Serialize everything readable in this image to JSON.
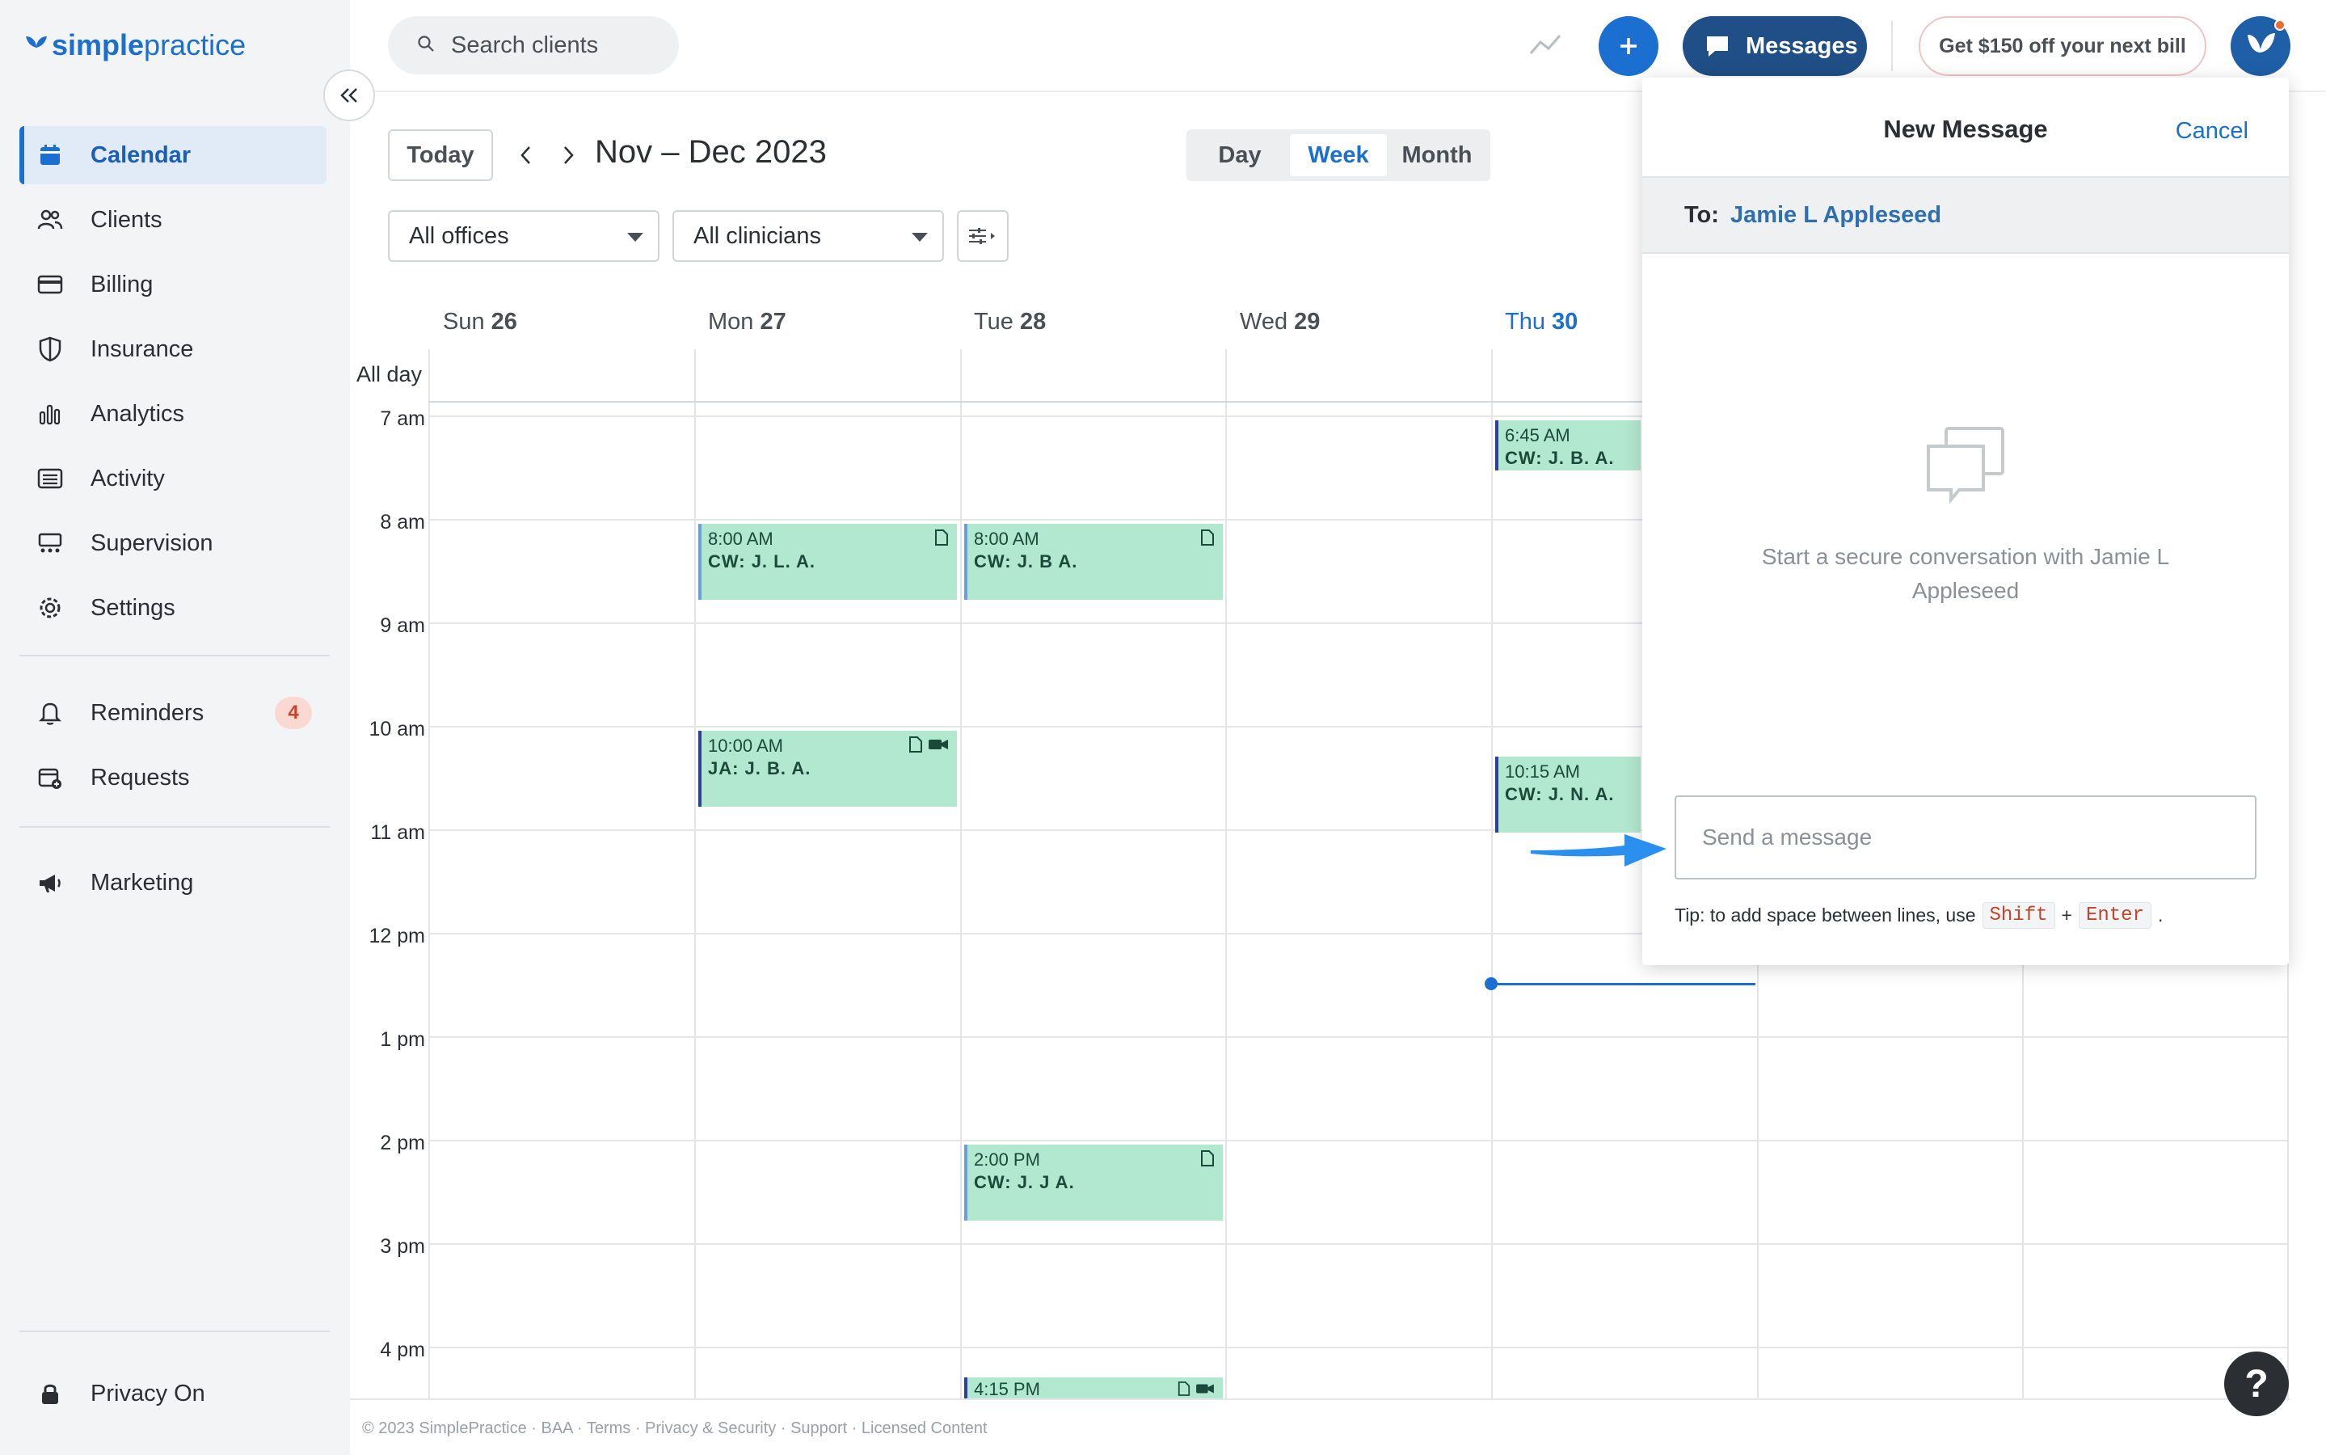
{
  "app": {
    "logo_simple": "simple",
    "logo_practice": "practice"
  },
  "sidebar": {
    "items": [
      {
        "label": "Calendar",
        "icon": "calendar-icon",
        "active": true
      },
      {
        "label": "Clients",
        "icon": "clients-icon"
      },
      {
        "label": "Billing",
        "icon": "billing-icon"
      },
      {
        "label": "Insurance",
        "icon": "shield-icon"
      },
      {
        "label": "Analytics",
        "icon": "analytics-icon"
      },
      {
        "label": "Activity",
        "icon": "activity-icon"
      },
      {
        "label": "Supervision",
        "icon": "supervision-icon"
      },
      {
        "label": "Settings",
        "icon": "gear-icon"
      }
    ],
    "reminders": {
      "label": "Reminders",
      "count": "4"
    },
    "requests": {
      "label": "Requests"
    },
    "marketing": {
      "label": "Marketing"
    },
    "privacy": {
      "label": "Privacy On"
    }
  },
  "topbar": {
    "search_placeholder": "Search clients",
    "messages_label": "Messages",
    "promo_label": "Get $150 off your next bill"
  },
  "toolbar": {
    "today_label": "Today",
    "range_title": "Nov – Dec 2023",
    "views": [
      "Day",
      "Week",
      "Month"
    ],
    "active_view": "Week",
    "offices_select": "All offices",
    "clinicians_select": "All clinicians"
  },
  "calendar": {
    "days": [
      {
        "name": "Sun",
        "num": "26"
      },
      {
        "name": "Mon",
        "num": "27"
      },
      {
        "name": "Tue",
        "num": "28"
      },
      {
        "name": "Wed",
        "num": "29"
      },
      {
        "name": "Thu",
        "num": "30",
        "today": true
      }
    ],
    "allday_label": "All day",
    "times": [
      "7 am",
      "8 am",
      "9 am",
      "10 am",
      "11 am",
      "12 pm",
      "1 pm",
      "2 pm",
      "3 pm",
      "4 pm"
    ],
    "events": [
      {
        "time": "8:00 AM",
        "name": "CW: J. L. A."
      },
      {
        "time": "8:00 AM",
        "name": "CW: J. B A."
      },
      {
        "time": "10:00 AM",
        "name": "JA: J. B. A."
      },
      {
        "time": "6:45 AM",
        "name": "CW: J. B. A."
      },
      {
        "time": "10:15 AM",
        "name": "CW: J. N. A."
      },
      {
        "time": "2:00 PM",
        "name": "CW: J. J A."
      },
      {
        "time": "4:15 PM",
        "name": ""
      }
    ]
  },
  "footer": {
    "text": "© 2023 SimplePractice · BAA · Terms · Privacy & Security · Support · Licensed Content"
  },
  "new_message": {
    "title": "New Message",
    "cancel_label": "Cancel",
    "to_label": "To:",
    "recipient": "Jamie L Appleseed",
    "empty_text": "Start a secure conversation with Jamie L Appleseed",
    "input_placeholder": "Send a message",
    "tip_text": "Tip: to add space between lines, use",
    "tip_key1": "Shift",
    "tip_plus": "+",
    "tip_key2": "Enter",
    "tip_end": "."
  },
  "help": {
    "label": "?"
  },
  "colors": {
    "accent": "#1a6fd0",
    "event": "#b2e8cf",
    "messages_button": "#1f4f86"
  }
}
